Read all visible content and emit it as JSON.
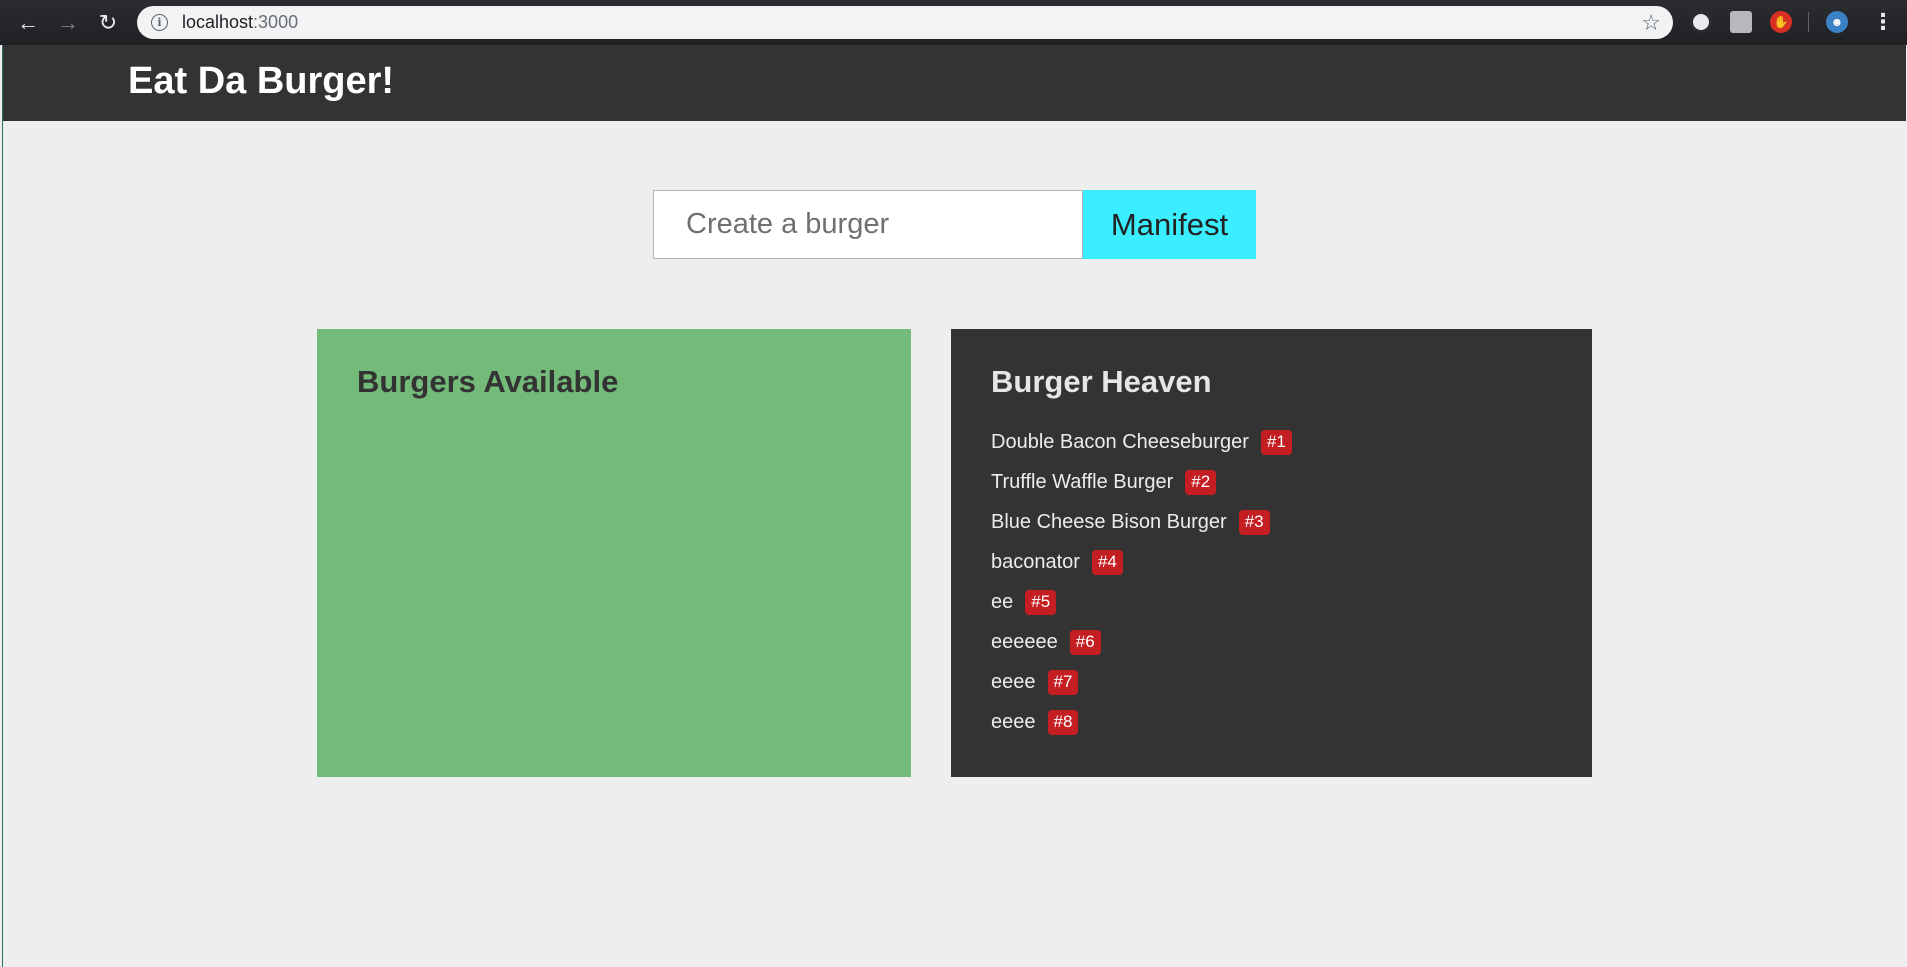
{
  "browser": {
    "url_host": "localhost",
    "url_port": ":3000",
    "icons": {
      "back": "arrow-left-icon",
      "forward": "arrow-right-icon",
      "reload": "reload-icon",
      "info": "info-icon",
      "star": "star-icon",
      "menu": "kebab-menu-icon"
    }
  },
  "navbar": {
    "brand": "Eat Da Burger!"
  },
  "form": {
    "placeholder": "Create a burger",
    "value": "",
    "button_label": "Manifest"
  },
  "available": {
    "title": "Burgers Available",
    "items": [],
    "background_color": "#74bb7a"
  },
  "heaven": {
    "title": "Burger Heaven",
    "background_color": "#333333",
    "items": [
      {
        "name": "Double Bacon Cheeseburger",
        "number": "#1"
      },
      {
        "name": "Truffle Waffle Burger",
        "number": "#2"
      },
      {
        "name": "Blue Cheese Bison Burger",
        "number": "#3"
      },
      {
        "name": "baconator",
        "number": "#4"
      },
      {
        "name": "ee",
        "number": "#5"
      },
      {
        "name": "eeeeee",
        "number": "#6"
      },
      {
        "name": "eeee",
        "number": "#7"
      },
      {
        "name": "eeee",
        "number": "#8"
      }
    ]
  },
  "colors": {
    "accent_button": "#3beeff",
    "badge": "#c41e23",
    "navbar": "#333333"
  }
}
